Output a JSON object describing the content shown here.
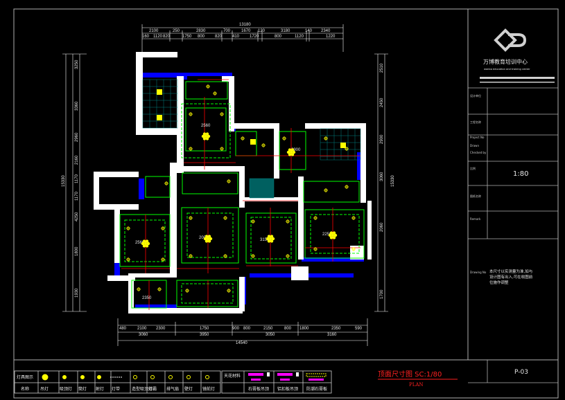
{
  "dimensions": {
    "top_total": "13180",
    "top_segments": [
      "2100",
      "250",
      "2830",
      "700",
      "1670",
      "120",
      "3180",
      "140",
      "2340"
    ],
    "top_subsegments": [
      "160",
      "1120",
      "820",
      "1750",
      "800",
      "820",
      "410",
      "1720",
      "800",
      "1120",
      "1220"
    ],
    "bottom_total": "14540",
    "bottom_segments_row1": [
      "480",
      "2100",
      "2300",
      "1750",
      "900",
      "800",
      "2150",
      "800",
      "1800",
      "2350",
      "590"
    ],
    "bottom_segments_row2": [
      "3060",
      "3950",
      "3050",
      "3160"
    ],
    "left_total": "15330",
    "left_segments": [
      "3250",
      "3360",
      "2960",
      "2160",
      "1170",
      "1170",
      "4250",
      "1800",
      "1930"
    ],
    "right_total": "15330",
    "right_segments": [
      "2510",
      "2450",
      "2900",
      "3060",
      "2060",
      "1700"
    ]
  },
  "room_labels": [
    "2560",
    "2000",
    "2560",
    "3150",
    "2250",
    "2900",
    "2350"
  ],
  "title_block": {
    "company_cn": "万博教育培训中心",
    "company_en": "wanbo  education and training  center",
    "field_labels": [
      "设计单位",
      "工程名称",
      "Project No",
      "Drawn",
      "Checked by",
      "比例",
      "图纸名称",
      "Remark",
      "Drawing No"
    ],
    "scale": "1:80",
    "remark": "本尺寸以实测量为准,如与设计图有出入,可在收图前位施作调整",
    "drawing_no": "P-03"
  },
  "legend": {
    "header": "灯具图示",
    "name_label": "名称",
    "items": [
      "吊灯",
      "吸顶灯",
      "筒灯",
      "射灯",
      "灯带",
      "造型吸顶灯",
      "浴霸",
      "排气扇",
      "壁灯",
      "镜前灯"
    ],
    "materials_header": "天花材料",
    "materials": [
      "石膏板吊顶",
      "铝扣板吊顶",
      "防潮石膏板"
    ]
  },
  "drawing_title": {
    "main": "顶面尺寸图  SC:1/80",
    "sub": "PLAN"
  },
  "colors": {
    "background": "#000000",
    "wall": "#ffffff",
    "dim_line": "#ffffff",
    "ceiling_green": "#00ff00",
    "dimension_red": "#ff0000",
    "light_yellow": "#ffff00",
    "window_blue": "#0000ff",
    "tile_cyan": "#008080",
    "title_red": "#ff2020",
    "border_grey": "#b0b0b0",
    "magenta": "#ff00ff"
  },
  "icons": [
    "chandelier-icon",
    "ceiling-light-icon",
    "downlight-icon",
    "spotlight-icon",
    "bath-heater-icon",
    "exhaust-fan-icon"
  ]
}
